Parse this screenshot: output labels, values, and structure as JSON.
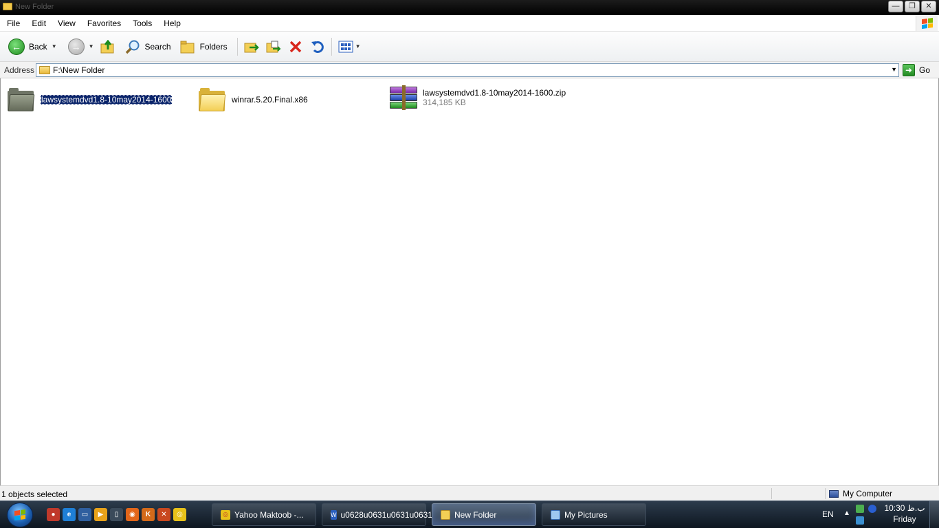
{
  "window": {
    "title": "New Folder",
    "controls": {
      "minimize": "—",
      "restore": "❐",
      "close": "✕"
    }
  },
  "menu": [
    "File",
    "Edit",
    "View",
    "Favorites",
    "Tools",
    "Help"
  ],
  "toolbar": {
    "back_label": "Back",
    "search_label": "Search",
    "folders_label": "Folders"
  },
  "address": {
    "label": "Address",
    "value": "F:\\New Folder",
    "go_label": "Go"
  },
  "files": [
    {
      "name": "lawsystemdvd1.8-10may2014-1600",
      "type": "folder",
      "selected": true
    },
    {
      "name": "winrar.5.20.Final.x86",
      "type": "folder",
      "selected": false
    },
    {
      "name": "lawsystemdvd1.8-10may2014-1600.zip",
      "type": "winrar-archive",
      "size": "314,185 KB"
    }
  ],
  "status": {
    "selection": "1 objects selected",
    "location": "My Computer"
  },
  "taskbar": {
    "tasks": [
      {
        "label": "Yahoo Maktoob -...",
        "icon": "chrome-icon",
        "active": false
      },
      {
        "label": "u0628u0631u0631u0631...",
        "icon": "word-icon",
        "active": false
      },
      {
        "label": "New Folder",
        "icon": "folder-icon",
        "active": true
      },
      {
        "label": "My Pictures",
        "icon": "pictures-icon",
        "active": false
      }
    ],
    "language": "EN",
    "time": "10:30 ب.ظ",
    "day": "Friday"
  },
  "colors": {
    "selection": "#0a246a",
    "taskbar": "#1a2633",
    "folder_yellow": "#f3cf55"
  }
}
